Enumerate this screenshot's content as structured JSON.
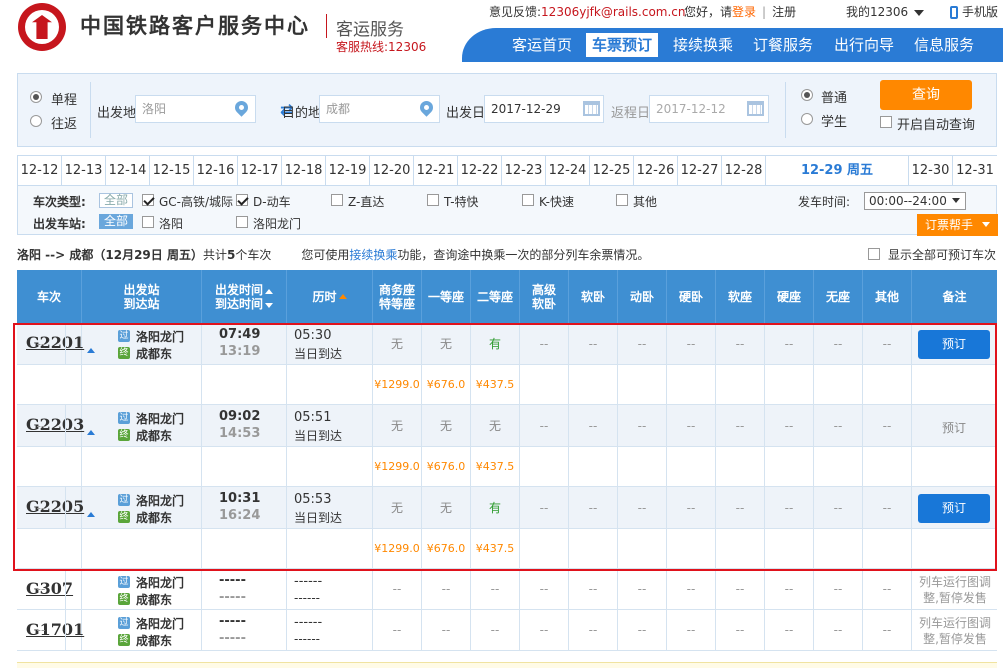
{
  "header": {
    "brand": "中国铁路客户服务中心",
    "service": "客运服务",
    "hotline": "客服热线:12306",
    "feedback_label": "意见反馈:",
    "feedback_email": "12306yjfk@rails.com.cn",
    "greeting": "您好，请",
    "login": "登录",
    "register": "注册",
    "my12306": "我的12306",
    "mobile": "手机版",
    "nav": [
      "客运首页",
      "车票预订",
      "接续换乘",
      "订餐服务",
      "出行向导",
      "信息服务"
    ],
    "nav_active": "车票预订"
  },
  "search": {
    "trip_single": "单程",
    "trip_round": "往返",
    "from_label": "出发地",
    "from_value": "洛阳",
    "to_label": "目的地",
    "to_value": "成都",
    "depart_label": "出发日",
    "depart_value": "2017-12-29",
    "return_label": "返程日",
    "return_value": "2017-12-12",
    "ticket_normal": "普通",
    "ticket_student": "学生",
    "query_button": "查询",
    "auto_query": "开启自动查询"
  },
  "dates": [
    "12-12",
    "12-13",
    "12-14",
    "12-15",
    "12-16",
    "12-17",
    "12-18",
    "12-19",
    "12-20",
    "12-21",
    "12-22",
    "12-23",
    "12-24",
    "12-25",
    "12-26",
    "12-27",
    "12-28",
    "12-29 周五",
    "12-30",
    "12-31"
  ],
  "dates_active": "12-29 周五",
  "filters": {
    "type_label": "车次类型:",
    "type_all": "全部",
    "types": [
      {
        "label": "GC-高铁/城际",
        "checked": true
      },
      {
        "label": "D-动车",
        "checked": true
      },
      {
        "label": "Z-直达",
        "checked": false
      },
      {
        "label": "T-特快",
        "checked": false
      },
      {
        "label": "K-快速",
        "checked": false
      },
      {
        "label": "其他",
        "checked": false
      }
    ],
    "station_label": "出发车站:",
    "station_all": "全部",
    "stations": [
      "洛阳",
      "洛阳龙门"
    ],
    "time_label": "发车时间:",
    "time_value": "00:00--24:00",
    "helper_button": "订票帮手"
  },
  "summary": {
    "route": "洛阳 --> 成都（12月29日  周五）",
    "count_prefix": "共计",
    "count": "5",
    "count_suffix": "个车次",
    "hint_prefix": "您可使用",
    "hint_link": "接续换乘",
    "hint_suffix": "功能，查询途中换乘一次的部分列车余票情况。",
    "show_all": "显示全部可预订车次"
  },
  "table": {
    "headers": [
      "车次",
      "出发站",
      "到达站",
      "出发时间",
      "到达时间",
      "历时",
      "商务座",
      "特等座",
      "一等座",
      "二等座",
      "高级",
      "软卧",
      "软卧",
      "动卧",
      "硬卧",
      "软座",
      "硬座",
      "无座",
      "其他",
      "备注"
    ],
    "trains": [
      {
        "no": "G2201",
        "from": "洛阳龙门",
        "to": "成都东",
        "dep": "07:49",
        "arr": "13:19",
        "dur": "05:30",
        "dur_note": "当日到达",
        "seats": [
          "无",
          "无",
          "有",
          "--",
          "--",
          "--",
          "--",
          "--",
          "--",
          "--",
          "--",
          "--"
        ],
        "prices": [
          "¥1299.0",
          "¥676.0",
          "¥437.5"
        ],
        "action": "预订",
        "bookable": true
      },
      {
        "no": "G2203",
        "from": "洛阳龙门",
        "to": "成都东",
        "dep": "09:02",
        "arr": "14:53",
        "dur": "05:51",
        "dur_note": "当日到达",
        "seats": [
          "无",
          "无",
          "无",
          "--",
          "--",
          "--",
          "--",
          "--",
          "--",
          "--",
          "--",
          "--"
        ],
        "prices": [
          "¥1299.0",
          "¥676.0",
          "¥437.5"
        ],
        "action": "预订",
        "bookable": false
      },
      {
        "no": "G2205",
        "from": "洛阳龙门",
        "to": "成都东",
        "dep": "10:31",
        "arr": "16:24",
        "dur": "05:53",
        "dur_note": "当日到达",
        "seats": [
          "无",
          "无",
          "有",
          "--",
          "--",
          "--",
          "--",
          "--",
          "--",
          "--",
          "--",
          "--"
        ],
        "prices": [
          "¥1299.0",
          "¥676.0",
          "¥437.5"
        ],
        "action": "预订",
        "bookable": true
      },
      {
        "no": "G307",
        "from": "洛阳龙门",
        "to": "成都东",
        "dep": "-----",
        "arr": "-----",
        "dur": "------",
        "dur_note": "------",
        "seats": [
          "--",
          "--",
          "--",
          "--",
          "--",
          "--",
          "--",
          "--",
          "--",
          "--",
          "--",
          "--"
        ],
        "note_line1": "列车运行图调",
        "note_line2": "整,暂停发售"
      },
      {
        "no": "G1701",
        "from": "洛阳龙门",
        "to": "成都东",
        "dep": "-----",
        "arr": "-----",
        "dur": "------",
        "dur_note": "------",
        "seats": [
          "--",
          "--",
          "--",
          "--",
          "--",
          "--",
          "--",
          "--",
          "--",
          "--",
          "--",
          "--"
        ],
        "note_line1": "列车运行图调",
        "note_line2": "整,暂停发售"
      }
    ],
    "icon_pass": "过",
    "icon_end": "终"
  },
  "colors": {
    "brand_red": "#c6161d",
    "nav_blue": "#2a7bd5",
    "header_blue": "#3f8fd2",
    "orange": "#ff8800",
    "available_green": "#2b9a2b",
    "highlight_red": "#e0121c"
  }
}
